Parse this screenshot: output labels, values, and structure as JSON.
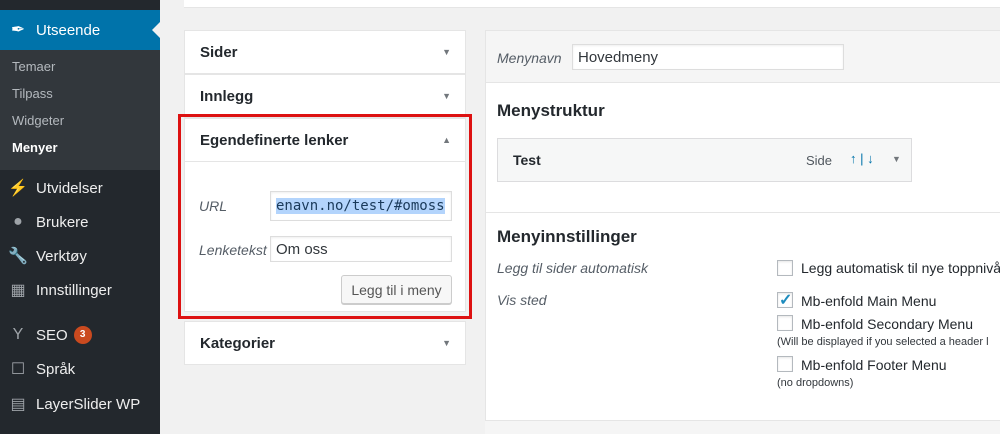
{
  "sidebar": {
    "active": {
      "label": "Utseende",
      "icon": "brush-icon"
    },
    "submenu": [
      "Temaer",
      "Tilpass",
      "Widgeter",
      "Menyer"
    ],
    "items": [
      {
        "label": "Utvidelser",
        "icon": "plug-icon"
      },
      {
        "label": "Brukere",
        "icon": "user-icon"
      },
      {
        "label": "Verktøy",
        "icon": "wrench-icon"
      },
      {
        "label": "Innstillinger",
        "icon": "settings-icon"
      },
      {
        "label": "SEO",
        "icon": "yoast-icon",
        "badge": "3"
      },
      {
        "label": "Språk",
        "icon": "translate-icon"
      },
      {
        "label": "LayerSlider WP",
        "icon": "layers-icon"
      }
    ]
  },
  "accordion": {
    "sider": "Sider",
    "innlegg": "Innlegg",
    "custom": "Egendefinerte lenker",
    "kategorier": "Kategorier",
    "url_label": "URL",
    "url_value": "enavn.no/test/#omoss",
    "link_text_label": "Lenketekst",
    "link_text_value": "Om oss",
    "add_button": "Legg til i meny"
  },
  "menu": {
    "name_label": "Menynavn",
    "name_value": "Hovedmeny",
    "structure_title": "Menystruktur",
    "item": {
      "title": "Test",
      "type": "Side",
      "move": "↑ | ↓"
    },
    "settings_title": "Menyinnstillinger",
    "auto_add_label": "Legg til sider automatisk",
    "auto_add_option": "Legg automatisk til nye toppnivå",
    "location_label": "Vis sted",
    "locations": [
      {
        "label": "Mb-enfold Main Menu",
        "checked": true
      },
      {
        "label": "Mb-enfold Secondary Menu",
        "checked": false,
        "note": "(Will be displayed if you selected a header l"
      },
      {
        "label": "Mb-enfold Footer Menu",
        "checked": false,
        "note": "(no dropdowns)"
      }
    ]
  }
}
